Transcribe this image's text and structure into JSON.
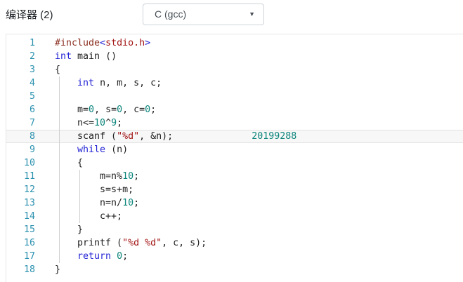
{
  "header": {
    "label": "编译器 (2)",
    "select_value": "C (gcc)",
    "dropdown_arrow": "▼"
  },
  "colors": {
    "keyword": "#2424d6",
    "number": "#0b857b",
    "string": "#a31515",
    "preprocessor": "#8b2f20",
    "line_number": "#2b91af",
    "plain_text": "#1f1f1f",
    "highlight_row_bg": "#f7f7f7",
    "highlight_row_border": "#e2e2e2",
    "panel_border": "#e7e7e7",
    "select_border": "#ced4da"
  },
  "editor": {
    "language": "C (gcc)",
    "highlighted_line": 8,
    "annotation_on_line_8": "20199288",
    "lines": [
      {
        "n": 1,
        "segments": [
          {
            "t": "#include",
            "c": "pp"
          },
          {
            "t": "<",
            "c": "kw"
          },
          {
            "t": "stdio.h",
            "c": "str"
          },
          {
            "t": ">",
            "c": "kw"
          }
        ]
      },
      {
        "n": 2,
        "segments": [
          {
            "t": "int",
            "c": "kw"
          },
          {
            "t": " main ()",
            "c": "pl"
          }
        ]
      },
      {
        "n": 3,
        "segments": [
          {
            "t": "{",
            "c": "pl"
          }
        ]
      },
      {
        "n": 4,
        "segments": [
          {
            "t": "    ",
            "c": "pl"
          },
          {
            "t": "int",
            "c": "kw"
          },
          {
            "t": " n, m, s, c;",
            "c": "pl"
          }
        ]
      },
      {
        "n": 5,
        "segments": []
      },
      {
        "n": 6,
        "segments": [
          {
            "t": "    m=",
            "c": "pl"
          },
          {
            "t": "0",
            "c": "num"
          },
          {
            "t": ", s=",
            "c": "pl"
          },
          {
            "t": "0",
            "c": "num"
          },
          {
            "t": ", c=",
            "c": "pl"
          },
          {
            "t": "0",
            "c": "num"
          },
          {
            "t": ";",
            "c": "pl"
          }
        ]
      },
      {
        "n": 7,
        "segments": [
          {
            "t": "    n<=",
            "c": "pl"
          },
          {
            "t": "10",
            "c": "num"
          },
          {
            "t": "^",
            "c": "pl"
          },
          {
            "t": "9",
            "c": "num"
          },
          {
            "t": ";",
            "c": "pl"
          }
        ]
      },
      {
        "n": 8,
        "highlight": true,
        "segments": [
          {
            "t": "    scanf (",
            "c": "pl"
          },
          {
            "t": "\"%d\"",
            "c": "str"
          },
          {
            "t": ", &n);",
            "c": "pl"
          },
          {
            "t": "              ",
            "c": "pl"
          },
          {
            "t": "20199288",
            "c": "num"
          }
        ]
      },
      {
        "n": 9,
        "segments": [
          {
            "t": "    ",
            "c": "pl"
          },
          {
            "t": "while",
            "c": "kw"
          },
          {
            "t": " (n)",
            "c": "pl"
          }
        ]
      },
      {
        "n": 10,
        "segments": [
          {
            "t": "    {",
            "c": "pl"
          }
        ]
      },
      {
        "n": 11,
        "segments": [
          {
            "t": "        m=n%",
            "c": "pl"
          },
          {
            "t": "10",
            "c": "num"
          },
          {
            "t": ";",
            "c": "pl"
          }
        ]
      },
      {
        "n": 12,
        "segments": [
          {
            "t": "        s=s+m;",
            "c": "pl"
          }
        ]
      },
      {
        "n": 13,
        "segments": [
          {
            "t": "        n=n/",
            "c": "pl"
          },
          {
            "t": "10",
            "c": "num"
          },
          {
            "t": ";",
            "c": "pl"
          }
        ]
      },
      {
        "n": 14,
        "segments": [
          {
            "t": "        c++;",
            "c": "pl"
          }
        ]
      },
      {
        "n": 15,
        "segments": [
          {
            "t": "    }",
            "c": "pl"
          }
        ]
      },
      {
        "n": 16,
        "segments": [
          {
            "t": "    printf (",
            "c": "pl"
          },
          {
            "t": "\"%d %d\"",
            "c": "str"
          },
          {
            "t": ", c, s);",
            "c": "pl"
          }
        ]
      },
      {
        "n": 17,
        "segments": [
          {
            "t": "    ",
            "c": "pl"
          },
          {
            "t": "return",
            "c": "kw"
          },
          {
            "t": " ",
            "c": "pl"
          },
          {
            "t": "0",
            "c": "num"
          },
          {
            "t": ";",
            "c": "pl"
          }
        ]
      },
      {
        "n": 18,
        "segments": [
          {
            "t": "}",
            "c": "pl"
          }
        ]
      }
    ]
  }
}
